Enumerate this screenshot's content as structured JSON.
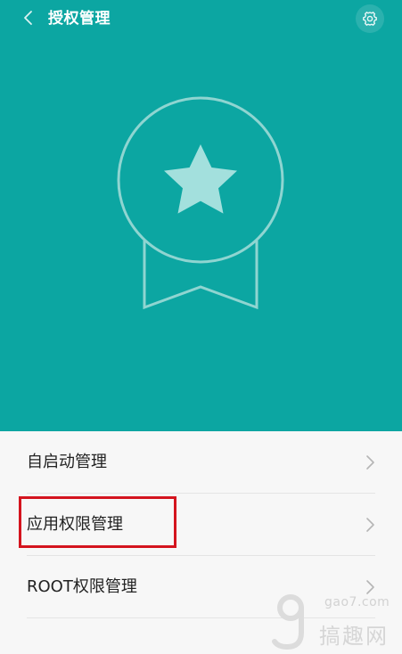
{
  "header": {
    "title": "授权管理",
    "back_icon": "chevron-left-icon",
    "settings_icon": "gear-icon",
    "badge_icon": "award-star-icon",
    "background": "#0ca6a2"
  },
  "list": {
    "items": [
      {
        "label": "自启动管理"
      },
      {
        "label": "应用权限管理",
        "highlighted": true
      },
      {
        "label": "ROOT权限管理"
      }
    ]
  },
  "highlight_color": "#d4141e",
  "watermark": {
    "domain": "gao7.com",
    "name": "搞趣网"
  }
}
